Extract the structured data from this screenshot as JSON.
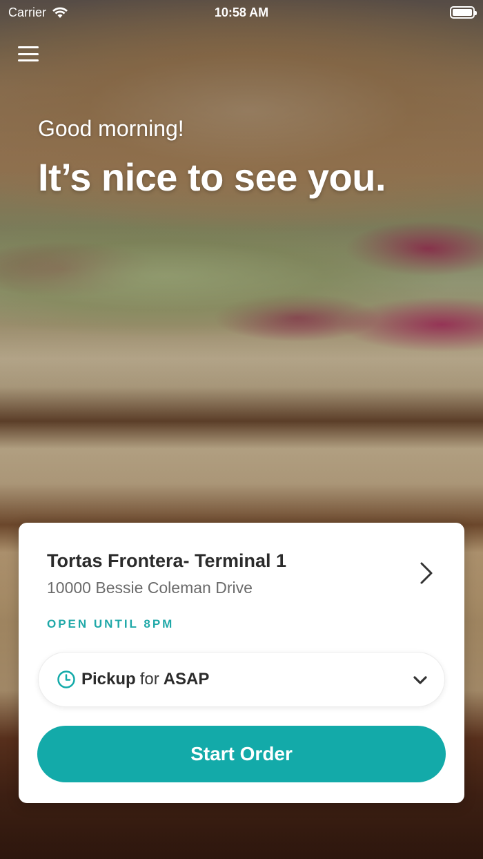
{
  "status_bar": {
    "carrier": "Carrier",
    "time": "10:58 AM",
    "battery_level": 1.0
  },
  "header": {
    "menu_icon": "hamburger-menu-icon"
  },
  "greeting": {
    "line1": "Good morning!",
    "line2": "It’s nice to see you."
  },
  "store": {
    "name": "Tortas Frontera- Terminal 1",
    "address": "10000 Bessie Coleman Drive",
    "hours": "OPEN UNTIL 8PM"
  },
  "pickup": {
    "mode": "Pickup",
    "connector": "for",
    "time": "ASAP"
  },
  "actions": {
    "start_order": "Start Order"
  },
  "colors": {
    "accent": "#13aaa9",
    "hours_text": "#1fa8a8",
    "title_text": "#2b2b2b",
    "address_text": "#6b6b6b"
  }
}
